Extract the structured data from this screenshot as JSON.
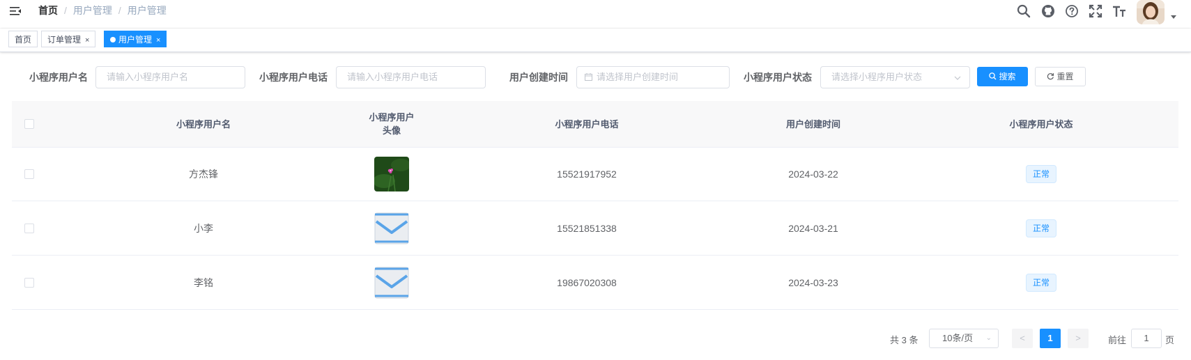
{
  "breadcrumb": [
    "首页",
    "用户管理",
    "用户管理"
  ],
  "navbar_icons": [
    "search-icon",
    "github-icon",
    "question-icon",
    "fullscreen-icon",
    "font-size-icon"
  ],
  "tags": [
    {
      "label": "首页",
      "active": false
    },
    {
      "label": "订单管理",
      "active": false,
      "close": "×"
    },
    {
      "label": "用户管理",
      "active": true,
      "close": "×"
    }
  ],
  "search": {
    "name_label": "小程序用户名",
    "name_placeholder": "请输入小程序用户名",
    "phone_label": "小程序用户电话",
    "phone_placeholder": "请输入小程序用户电话",
    "time_label": "用户创建时间",
    "time_placeholder": "请选择用户创建时间",
    "status_label": "小程序用户状态",
    "status_placeholder": "请选择小程序用户状态",
    "search_button": "搜索",
    "reset_button": "重置"
  },
  "table": {
    "headers": [
      "小程序用户名",
      "小程序用户头像",
      "小程序用户电话",
      "用户创建时间",
      "小程序用户状态"
    ],
    "rows": [
      {
        "name": "方杰锋",
        "avatar": "flower-photo",
        "phone": "15521917952",
        "created": "2024-03-22",
        "status": "正常"
      },
      {
        "name": "小李",
        "avatar": "envelope-icon",
        "phone": "15521851338",
        "created": "2024-03-21",
        "status": "正常"
      },
      {
        "name": "李铭",
        "avatar": "envelope-icon",
        "phone": "19867020308",
        "created": "2024-03-23",
        "status": "正常"
      }
    ]
  },
  "pagination": {
    "total": "共 3 条",
    "page_size": "10条/页",
    "prev": "<",
    "current": "1",
    "next": ">",
    "goto_label": "前往",
    "goto_value": "1",
    "page_suffix": "页"
  },
  "colors": {
    "primary": "#1890ff",
    "header_bg": "#f8f8f9",
    "tag_bg": "#e8f4ff"
  }
}
